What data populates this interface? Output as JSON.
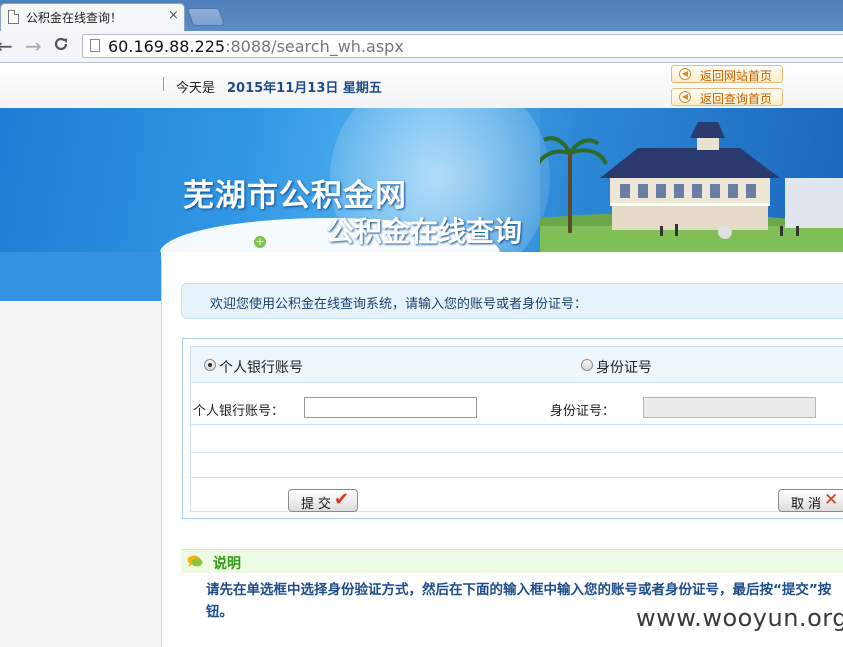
{
  "browser": {
    "tab_title": "公积金在线查询！",
    "tab_close": "×",
    "back_glyph": "←",
    "forward_glyph": "→",
    "reload_glyph": "C",
    "url_host": "60.169.88.225",
    "url_rest": ":8088/search_wh.aspx"
  },
  "header": {
    "date_label": "今天是",
    "date_value": "2015年11月13日 星期五",
    "link_home": "返回网站首页",
    "link_query": "返回查询首页",
    "link_arrow": "◀"
  },
  "banner": {
    "site_name": "芜湖市公积金网",
    "subtitle": "公积金在线查询",
    "plus_glyph": "+"
  },
  "main": {
    "welcome": "欢迎您使用公积金在线查询系统，请输入您的账号或者身份证号：",
    "radio_bank": "个人银行账号",
    "radio_id": "身份证号",
    "label_bank": "个人银行账号：",
    "label_id": "身份证号：",
    "bank_value": "",
    "id_value": "",
    "submit_label": "提交",
    "submit_icon": "✔",
    "cancel_label": "取消",
    "cancel_icon": "✕"
  },
  "notes": {
    "title": "说明",
    "text": "请先在单选框中选择身份验证方式，然后在下面的输入框中输入您的账号或者身份证号，最后按“提交”按钮。"
  },
  "watermark": "www.wooyun.org",
  "colors": {
    "banner_blue": "#2f96e4",
    "link_orange": "#c95f00",
    "note_green": "#2f9a16",
    "text_blue": "#1d4c89"
  }
}
